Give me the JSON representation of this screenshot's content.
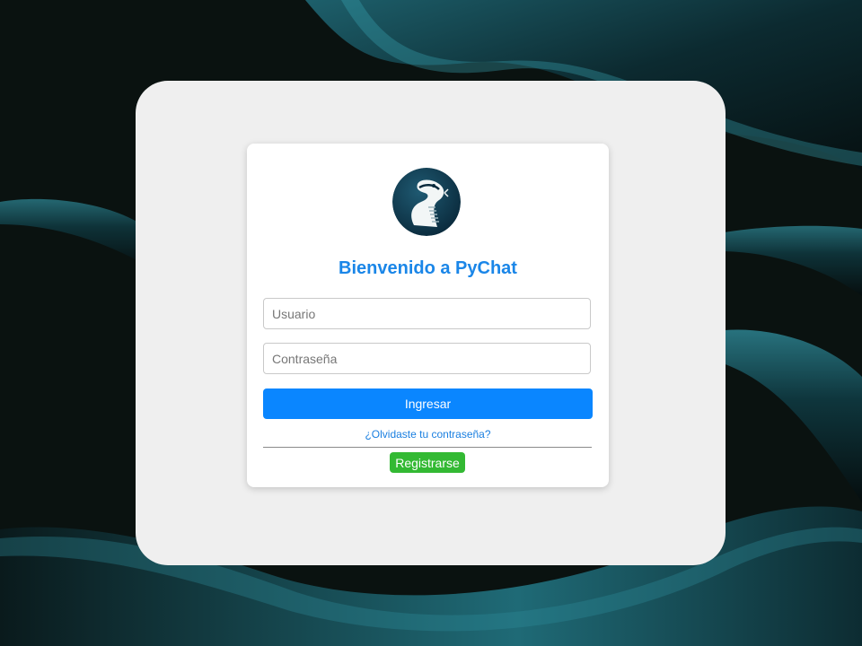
{
  "login": {
    "title": "Bienvenido a PyChat",
    "username_placeholder": "Usuario",
    "password_placeholder": "Contraseña",
    "login_button": "Ingresar",
    "forgot_link": "¿Olvidaste tu contraseña?",
    "register_button": "Registrarse"
  },
  "colors": {
    "title": "#1a86e8",
    "login_button": "#0a86ff",
    "register_button": "#33b933",
    "outer_card": "#efefef",
    "background": "#0a1210"
  },
  "icons": {
    "logo": "python-snake-logo-icon"
  }
}
